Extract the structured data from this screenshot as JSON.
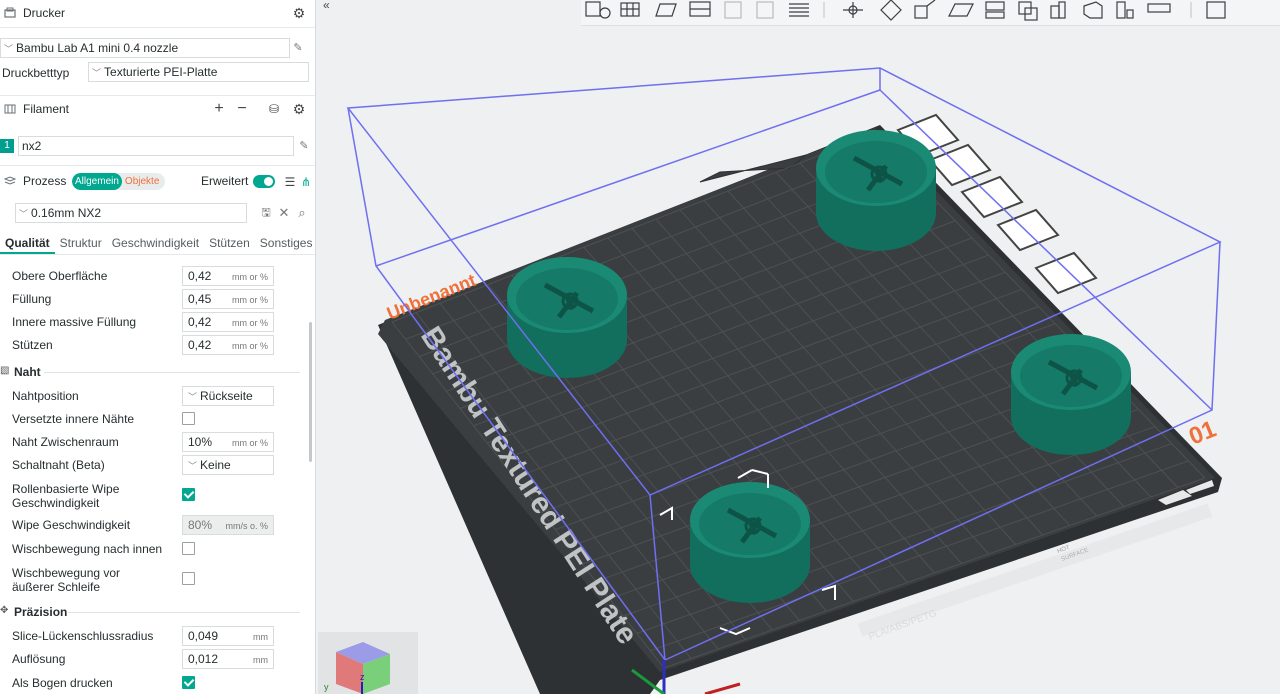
{
  "printer": {
    "header": "Drucker",
    "preset": "Bambu Lab A1 mini 0.4 nozzle",
    "bed_label": "Druckbetttyp",
    "bed_value": "Texturierte PEI-Platte"
  },
  "filament": {
    "header": "Filament",
    "slot_number": "1",
    "name": "nx2",
    "color": "#009e8f"
  },
  "process": {
    "header": "Prozess",
    "mode_global": "Allgemein",
    "mode_objects": "Objekte",
    "advanced_label": "Erweitert",
    "preset": "0.16mm NX2"
  },
  "tabs": [
    "Qualität",
    "Struktur",
    "Geschwindigkeit",
    "Stützen",
    "Sonstiges"
  ],
  "settings": {
    "obere_oberflaeche": {
      "label": "Obere Oberfläche",
      "value": "0,42",
      "unit": "mm or %"
    },
    "fuellung": {
      "label": "Füllung",
      "value": "0,45",
      "unit": "mm or %"
    },
    "innere_fuellung": {
      "label": "Innere massive Füllung",
      "value": "0,42",
      "unit": "mm or %"
    },
    "stuetzen": {
      "label": "Stützen",
      "value": "0,42",
      "unit": "mm or %"
    },
    "naht_group": "Naht",
    "nahtposition": {
      "label": "Nahtposition",
      "value": "Rückseite"
    },
    "versetzte": {
      "label": "Versetzte innere Nähte"
    },
    "naht_zwischenraum": {
      "label": "Naht Zwischenraum",
      "value": "10%",
      "unit": "mm or %"
    },
    "schaltnaht": {
      "label": "Schaltnaht (Beta)",
      "value": "Keine"
    },
    "rollenbasierte_1": "Rollenbasierte Wipe",
    "rollenbasierte_2": "Geschwindigkeit",
    "wipe_geschw": {
      "label": "Wipe Geschwindigkeit",
      "value": "80%",
      "unit": "mm/s o. %"
    },
    "wischbewegung_innen": {
      "label": "Wischbewegung nach innen"
    },
    "wischbewegung_vor_1": "Wischbewegung vor",
    "wischbewegung_vor_2": "äußerer Schleife",
    "praezision_group": "Präzision",
    "slice_luecken": {
      "label": "Slice-Lückenschlussradius",
      "value": "0,049",
      "unit": "mm"
    },
    "aufloesung": {
      "label": "Auflösung",
      "value": "0,012",
      "unit": "mm"
    },
    "bogen": {
      "label": "Als Bogen drucken"
    }
  },
  "viewport": {
    "plate_name": "Unbenannt",
    "plate_number": "01",
    "bed_text": "Bambu Textured PEI Plate",
    "bed_bottom_text": "PLA/ABS/PETG",
    "hot_surface_1": "HOT",
    "hot_surface_2": "SURFACE",
    "axis_z": "z",
    "axis_y": "y",
    "colors": {
      "bed": "#3b3e40",
      "part": "#1a8a75",
      "bbox": "#6f6ff0",
      "accent": "#f07039"
    }
  }
}
